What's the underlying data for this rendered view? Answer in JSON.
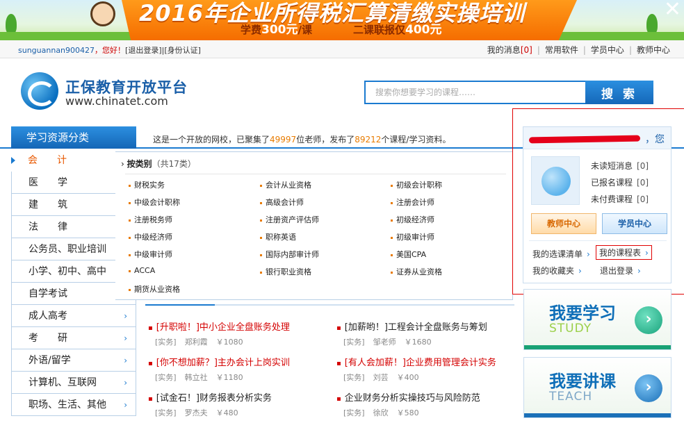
{
  "banner": {
    "title": "2016年企业所得税汇算清缴实操培训",
    "fee_prefix": "学费",
    "fee_value": "300元",
    "fee_suffix": "/课",
    "combo_prefix": "二课联报仅",
    "combo_value": "400元",
    "close_label": "✕"
  },
  "topbar": {
    "username": "sunguannan900427",
    "greeting": "，您好！",
    "logout": "[退出登录]",
    "verify": "|[身份认证]",
    "messages_label": "我的消息",
    "messages_count": "[0]",
    "links": [
      "常用软件",
      "学员中心",
      "教师中心"
    ]
  },
  "logo": {
    "cn": "正保教育开放平台",
    "en": "www.chinatet.com"
  },
  "search": {
    "placeholder": "搜索你想要学习的课程……",
    "button": "搜 索"
  },
  "category": {
    "header": "学习资源分类",
    "notice_a": "这是一个开放的网校，已聚集了",
    "teachers": "49997",
    "notice_b": "位老师，发布了",
    "courses": "89212",
    "notice_c": "个课程/学习资料。",
    "items": [
      {
        "label": "会　　计",
        "arrow": ""
      },
      {
        "label": "医　　学",
        "arrow": ""
      },
      {
        "label": "建　　筑",
        "arrow": ""
      },
      {
        "label": "法　　律",
        "arrow": ""
      },
      {
        "label": "公务员、职业培训",
        "arrow": ""
      },
      {
        "label": "小学、初中、高中",
        "arrow": ""
      },
      {
        "label": "自学考试",
        "arrow": ""
      },
      {
        "label": "成人高考",
        "arrow": "›"
      },
      {
        "label": "考　　研",
        "arrow": "›"
      },
      {
        "label": "外语/留学",
        "arrow": "›"
      },
      {
        "label": "计算机、互联网",
        "arrow": "›"
      },
      {
        "label": "职场、生活、其他",
        "arrow": "›"
      }
    ]
  },
  "panel": {
    "prefix": "›",
    "heading": "按类别",
    "count": "（共17类）",
    "subs": [
      "财税实务",
      "会计从业资格",
      "初级会计职称",
      "中级会计职称",
      "高级会计师",
      "注册会计师",
      "注册税务师",
      "注册资产评估师",
      "初级经济师",
      "中级经济师",
      "职称英语",
      "初级审计师",
      "中级审计师",
      "国际内部审计师",
      "美国CPA",
      "ACCA",
      "银行职业资格",
      "证券从业资格",
      "期货从业资格"
    ]
  },
  "courses": [
    {
      "title": "[升职啦！]中小企业全盘账务处理",
      "red": true,
      "tag": "[实务]",
      "teacher": "郑利霞",
      "price": "￥1080"
    },
    {
      "title": "[加薪哟！]工程会计全盘账务与筹划",
      "red": false,
      "tag": "[实务]",
      "teacher": "邹老师",
      "price": "￥1680"
    },
    {
      "title": "[你不想加薪？]主办会计上岗实训",
      "red": true,
      "tag": "[实务]",
      "teacher": "韩立社",
      "price": "￥1180"
    },
    {
      "title": "[有人会加薪！]企业费用管理会计实务",
      "red": true,
      "tag": "[实务]",
      "teacher": "刘芸",
      "price": "￥400"
    },
    {
      "title": "[试金石！]财务报表分析实务",
      "red": false,
      "tag": "[实务]",
      "teacher": "罗杰夫",
      "price": "￥480"
    },
    {
      "title": "企业财务分析实操技巧与风险防范",
      "red": false,
      "tag": "[实务]",
      "teacher": "徐欣",
      "price": "￥580"
    }
  ],
  "user": {
    "suffix": "，您",
    "stats": [
      {
        "label": "未读短消息",
        "count": "[0]"
      },
      {
        "label": "已报名课程",
        "count": "[0]"
      },
      {
        "label": "未付费课程",
        "count": "[0]"
      }
    ],
    "teacher_btn": "教师中心",
    "student_btn": "学员中心",
    "links": [
      "我的选课清单",
      "我的课程表",
      "我的收藏夹",
      "退出登录"
    ],
    "chev": "›"
  },
  "promo": {
    "study_cn": "我要学习",
    "study_en": "STUDY",
    "teach_cn": "我要讲课",
    "teach_en": "TEACH",
    "go": "›"
  },
  "colors": {
    "brand_blue": "#1a7ad0",
    "accent_orange": "#e87b00",
    "alert_red": "#d40000"
  }
}
